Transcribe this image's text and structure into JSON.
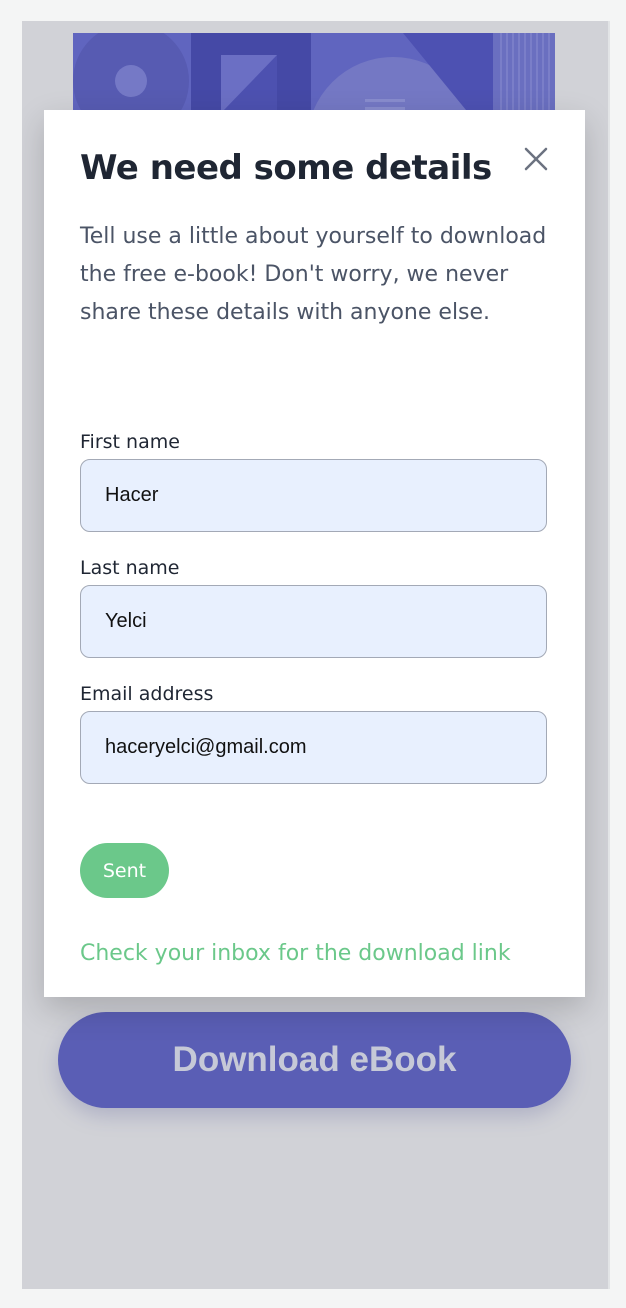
{
  "cta": {
    "label": "Download eBook"
  },
  "modal": {
    "title": "We need some details",
    "description": "Tell use a little about yourself to download the free e-book! Don't worry, we never share these details with anyone else.",
    "fields": [
      {
        "label": "First name",
        "value": "Hacer"
      },
      {
        "label": "Last name",
        "value": "Yelci"
      },
      {
        "label": "Email address",
        "value": "haceryelci@gmail.com"
      }
    ],
    "submit_label": "Sent",
    "success_message": "Check your inbox for the download link",
    "close_icon": "close-icon"
  },
  "colors": {
    "primary": "#3f44c8",
    "success": "#6bc88a",
    "field_background": "#e8f0fe",
    "heading": "#1f2633",
    "body_text": "#4b5466"
  }
}
